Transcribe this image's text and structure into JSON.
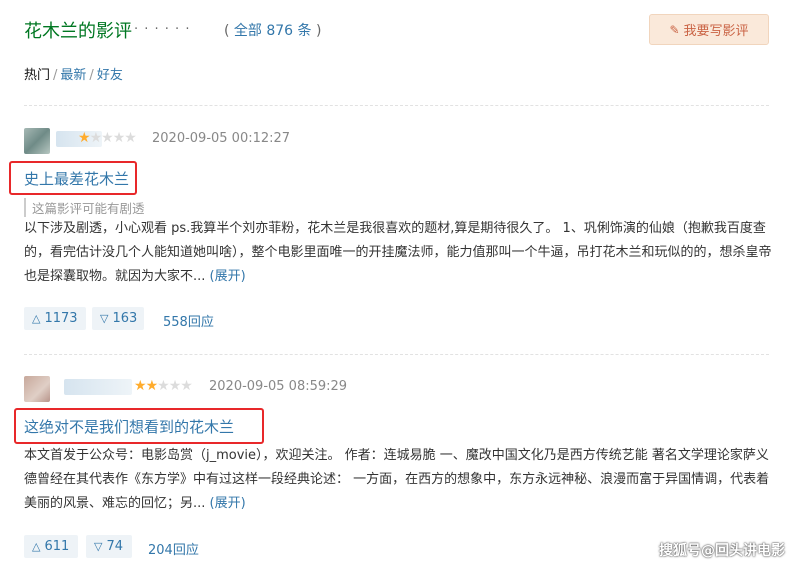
{
  "header": {
    "title": "花木兰的影评",
    "dots": "· · · · · ·",
    "total_open": "( ",
    "total_link": "全部 876 条",
    "total_close": " )",
    "write_button": "我要写影评"
  },
  "sort": {
    "hot": "热门",
    "latest": "最新",
    "friends": "好友",
    "separator": "/"
  },
  "reviews": [
    {
      "rating": 1,
      "max_rating": 5,
      "time": "2020-09-05 00:12:27",
      "title": "史上最差花木兰",
      "spoiler": "这篇影评可能有剧透",
      "body": "以下涉及剧透，小心观看 ps.我算半个刘亦菲粉，花木兰是我很喜欢的题材,算是期待很久了。 1、巩俐饰演的仙娘（抱歉我百度查的，看完估计没几个人能知道她叫啥），整个电影里面唯一的开挂魔法师，能力值那叫一个牛逼，吊打花木兰和玩似的的，想杀皇帝也是探囊取物。就因为大家不...",
      "expand": "(展开)",
      "up": "1173",
      "down": "163",
      "replies": "558回应"
    },
    {
      "rating": 2,
      "max_rating": 5,
      "time": "2020-09-05 08:59:29",
      "title": "这绝对不是我们想看到的花木兰",
      "spoiler": "",
      "body": "本文首发于公众号：电影岛赏（j_movie），欢迎关注。 作者：连城易脆 一、魔改中国文化乃是西方传统艺能 著名文学理论家萨义德曾经在其代表作《东方学》中有过这样一段经典论述： 一方面，在西方的想象中，东方永远神秘、浪漫而富于异国情调，代表着美丽的风景、难忘的回忆；另...",
      "expand": "(展开)",
      "up": "611",
      "down": "74",
      "replies": "204回应"
    }
  ],
  "icons": {
    "up": "△",
    "down": "▽",
    "pen": "✎",
    "star_on": "★",
    "star_off": "★"
  },
  "watermark": "搜狐号@回头讲电影"
}
